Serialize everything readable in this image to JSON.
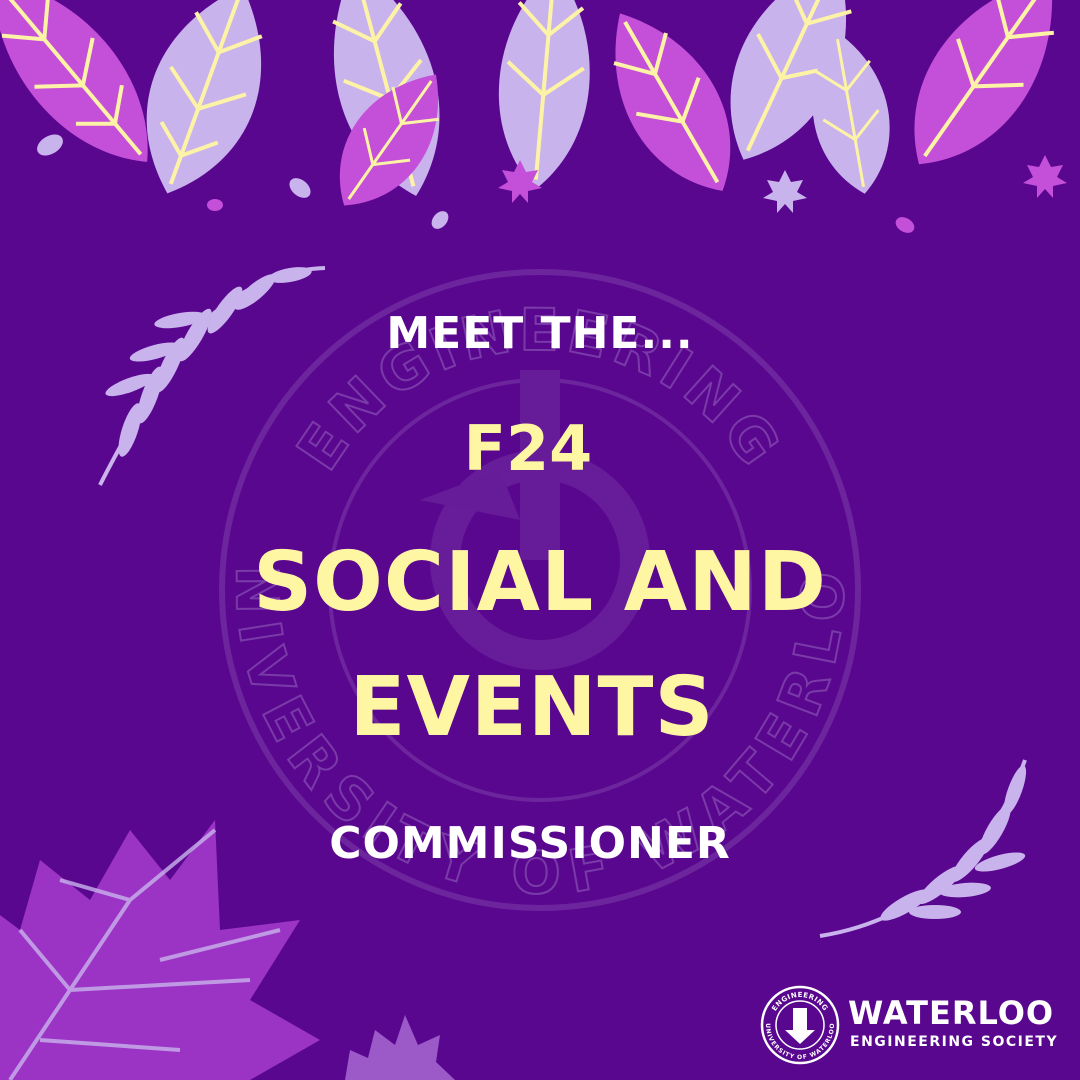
{
  "poster": {
    "lines": {
      "meet": "MEET THE...",
      "term": "F24",
      "role_1": "SOCIAL AND",
      "role_2": "EVENTS",
      "role_3": "COMMISSIONER"
    },
    "seal": {
      "text_top": "ENGINEERING",
      "text_bottom": "UNIVERSITY OF WATERLOO"
    },
    "brand": {
      "name": "WATERLOO",
      "subtitle": "ENGINEERING SOCIETY"
    }
  },
  "colors": {
    "background": "#5a078f",
    "text_white": "#ffffff",
    "text_yellow": "#fff6a3",
    "leaf_magenta": "#c44fd8",
    "leaf_lavender": "#c9b3ec",
    "leaf_vein": "#fdf3a6"
  },
  "icons": [
    "leaf-icon",
    "maple-leaf-icon",
    "sprig-icon",
    "seal-logo-icon"
  ]
}
